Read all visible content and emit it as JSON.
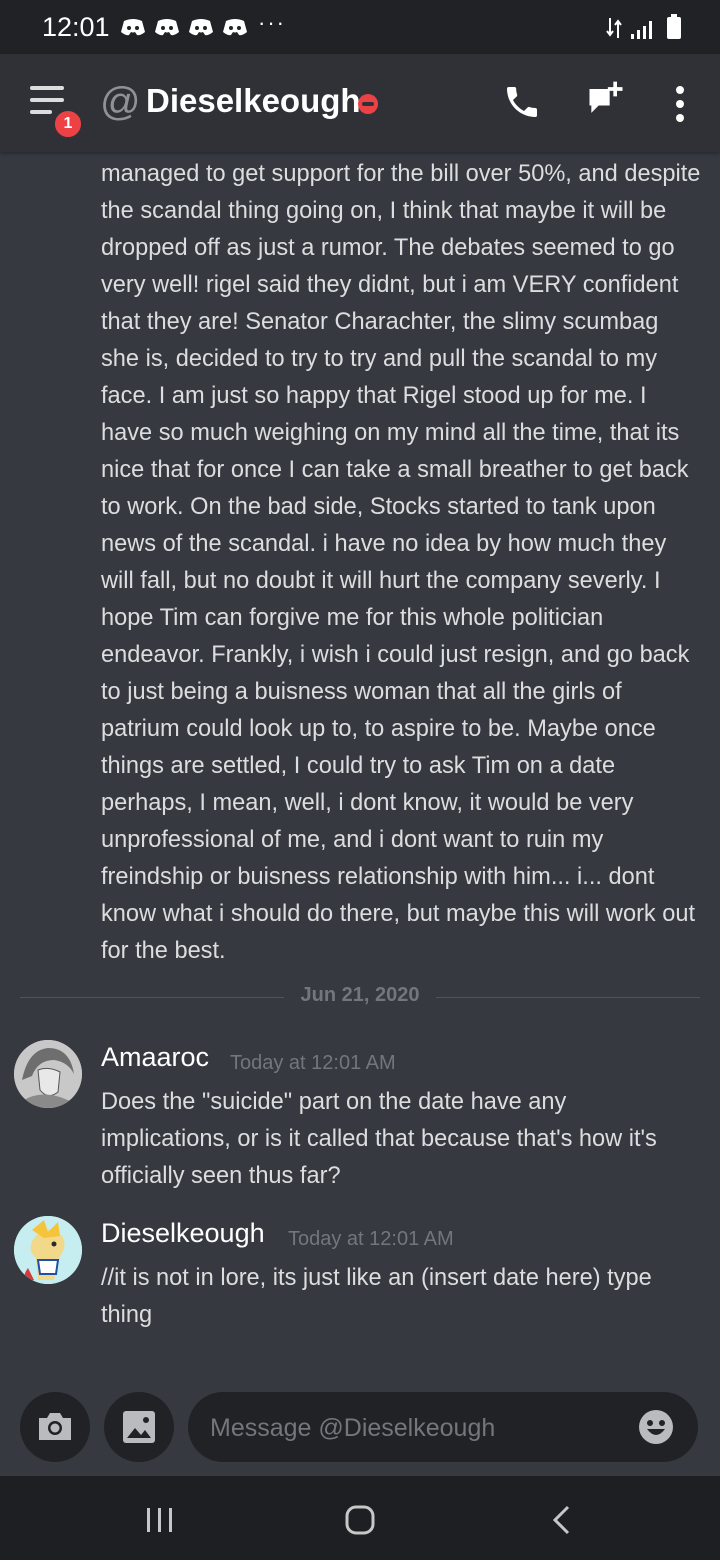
{
  "status_bar": {
    "time": "12:01",
    "notification_icons": [
      "discord-icon",
      "discord-icon",
      "discord-icon",
      "discord-icon"
    ],
    "more_indicator": "···"
  },
  "header": {
    "menu_badge": "1",
    "at_symbol": "@",
    "channel_name": "Dieselkeough",
    "status": "do-not-disturb"
  },
  "messages": {
    "continuation_text": "managed to get support for the bill over 50%, and despite the scandal thing going on, I think that maybe it will be dropped off as just a rumor. The debates seemed to go very well! rigel said they didnt, but i am VERY confident that they are! Senator Charachter, the slimy scumbag she is, decided to try to try and pull the scandal to my face. I am just so happy that Rigel stood up for me. I have so much weighing on my mind all the time, that its nice that for once I can take a small breather to get back to work. On the bad side, Stocks started to tank upon news of the scandal. i have no idea by how much they will fall, but no doubt it will hurt the company severly. I hope Tim can forgive me for this whole politician endeavor. Frankly, i wish i could just resign, and go back to just being a buisness woman that all the girls of patrium could look up to, to aspire to be. Maybe once things are settled, I could try to ask Tim on a date perhaps, I mean, well, i dont know, it would be very unprofessional of me, and i dont want to ruin my freindship or buisness relationship with him... i... dont know what i should do there, but maybe this will work out for the best.",
    "date_divider": "Jun 21, 2020",
    "items": [
      {
        "author": "Amaaroc",
        "timestamp": "Today at 12:01 AM",
        "text": "Does the \"suicide\" part on the date have any implications, or is it called that because that's how it's officially seen thus far?"
      },
      {
        "author": "Dieselkeough",
        "timestamp": "Today at 12:01 AM",
        "text": "//it is not in lore, its just like an (insert date here) type thing"
      }
    ]
  },
  "composer": {
    "placeholder": "Message @Dieselkeough"
  },
  "colors": {
    "background": "#36393f",
    "header": "#2f3136",
    "input": "#202225",
    "badge": "#ed4245",
    "status_dnd": "#ed4245"
  }
}
